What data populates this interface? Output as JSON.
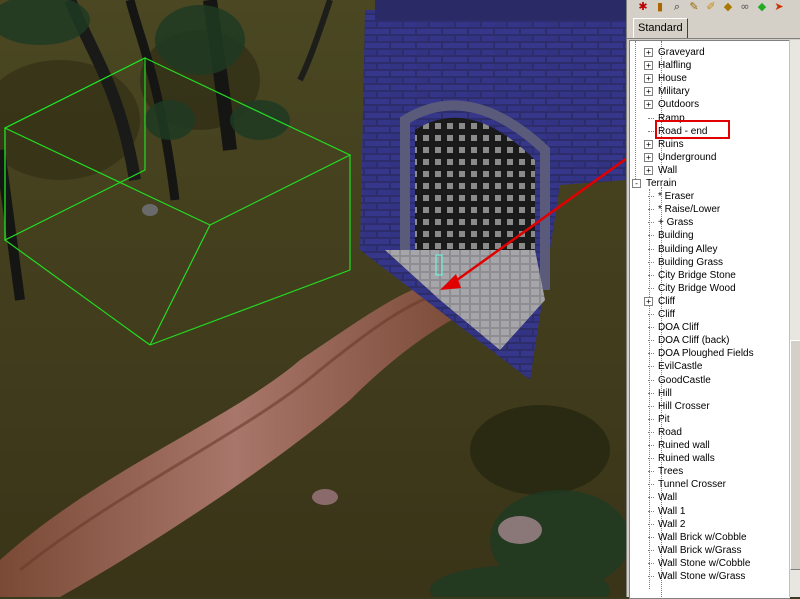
{
  "toolbar": {
    "icons": [
      "bug-icon",
      "book-icon",
      "search-icon",
      "pencil-icon",
      "brush-icon",
      "tag-icon",
      "link-icon",
      "gem-icon",
      "arrow-icon"
    ]
  },
  "tabs": [
    {
      "label": "Standard"
    }
  ],
  "tree": {
    "items": [
      {
        "label": "Graveyard",
        "expander": "+",
        "level": 2
      },
      {
        "label": "Halfling",
        "expander": "+",
        "level": 2
      },
      {
        "label": "House",
        "expander": "+",
        "level": 2
      },
      {
        "label": "Military",
        "expander": "+",
        "level": 2
      },
      {
        "label": "Outdoors",
        "expander": "+",
        "level": 2
      },
      {
        "label": "Ramp",
        "expander": "",
        "level": 2
      },
      {
        "label": "Road - end",
        "expander": "",
        "level": 2,
        "selected": true
      },
      {
        "label": "Ruins",
        "expander": "+",
        "level": 2
      },
      {
        "label": "Underground",
        "expander": "+",
        "level": 2
      },
      {
        "label": "Wall",
        "expander": "+",
        "level": 2
      },
      {
        "label": "Terrain",
        "expander": "-",
        "level": 1
      },
      {
        "label": "* Eraser",
        "expander": "",
        "level": 2
      },
      {
        "label": "* Raise/Lower",
        "expander": "",
        "level": 2
      },
      {
        "label": "+ Grass",
        "expander": "",
        "level": 2
      },
      {
        "label": "Building",
        "expander": "",
        "level": 2
      },
      {
        "label": "Building Alley",
        "expander": "",
        "level": 2
      },
      {
        "label": "Building Grass",
        "expander": "",
        "level": 2
      },
      {
        "label": "City Bridge Stone",
        "expander": "",
        "level": 2
      },
      {
        "label": "City Bridge Wood",
        "expander": "",
        "level": 2
      },
      {
        "label": "Cliff",
        "expander": "+",
        "level": 2
      },
      {
        "label": "Cliff",
        "expander": "",
        "level": 2
      },
      {
        "label": "DOA Cliff",
        "expander": "",
        "level": 2
      },
      {
        "label": "DOA Cliff (back)",
        "expander": "",
        "level": 2
      },
      {
        "label": "DOA Ploughed Fields",
        "expander": "",
        "level": 2
      },
      {
        "label": "EvilCastle",
        "expander": "",
        "level": 2
      },
      {
        "label": "GoodCastle",
        "expander": "",
        "level": 2
      },
      {
        "label": "Hill",
        "expander": "",
        "level": 2
      },
      {
        "label": "Hill Crosser",
        "expander": "",
        "level": 2
      },
      {
        "label": "Pit",
        "expander": "",
        "level": 2
      },
      {
        "label": "Road",
        "expander": "",
        "level": 2
      },
      {
        "label": "Ruined wall",
        "expander": "",
        "level": 2
      },
      {
        "label": "Ruined walls",
        "expander": "",
        "level": 2
      },
      {
        "label": "Trees",
        "expander": "",
        "level": 2
      },
      {
        "label": "Tunnel Crosser",
        "expander": "",
        "level": 2
      },
      {
        "label": "Wall",
        "expander": "",
        "level": 2
      },
      {
        "label": "Wall 1",
        "expander": "",
        "level": 2
      },
      {
        "label": "Wall 2",
        "expander": "",
        "level": 2
      },
      {
        "label": "Wall Brick w/Cobble",
        "expander": "",
        "level": 2
      },
      {
        "label": "Wall Brick w/Grass",
        "expander": "",
        "level": 2
      },
      {
        "label": "Wall Stone w/Cobble",
        "expander": "",
        "level": 2
      },
      {
        "label": "Wall Stone w/Grass",
        "expander": "",
        "level": 2
      }
    ]
  },
  "colors": {
    "highlight": "#e00000",
    "selection_box": "#22dd22"
  }
}
